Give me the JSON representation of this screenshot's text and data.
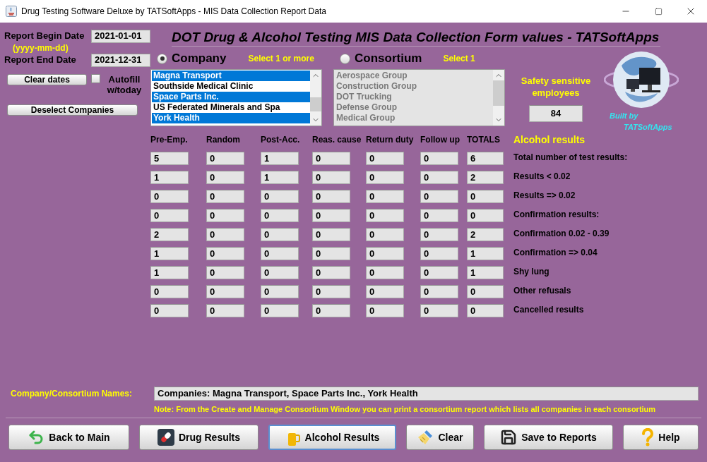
{
  "window": {
    "title": "Drug Testing Software Deluxe by TATSoftApps - MIS Data Collection Report Data"
  },
  "dates": {
    "begin_label": "Report Begin Date",
    "begin_value": "2021-01-01",
    "format_hint": "(yyyy-mm-dd)",
    "end_label": "Report End Date",
    "end_value": "2021-12-31"
  },
  "clear_dates_button": "Clear dates",
  "autofill": {
    "label": "Autofill w/today",
    "checked": false
  },
  "deselect_button": "Deselect Companies",
  "heading": "DOT Drug & Alcohol Testing MIS Data Collection Form values - TATSoftApps",
  "modes": [
    {
      "label": "Company",
      "hint": "Select 1 or more",
      "selected": true,
      "items": [
        {
          "label": "Magna Transport",
          "selected": true
        },
        {
          "label": "Southside Medical Clinic",
          "selected": false
        },
        {
          "label": "Space Parts Inc.",
          "selected": true
        },
        {
          "label": "US Federated Minerals and Spa",
          "selected": false
        },
        {
          "label": "York Health",
          "selected": true
        }
      ]
    },
    {
      "label": "Consortium",
      "hint": "Select 1",
      "selected": false,
      "items": [
        {
          "label": "Aerospace Group",
          "selected": false
        },
        {
          "label": "Construction Group",
          "selected": false
        },
        {
          "label": "DOT Trucking",
          "selected": false
        },
        {
          "label": "Defense Group",
          "selected": false
        },
        {
          "label": "Medical Group",
          "selected": false
        }
      ]
    }
  ],
  "safety": {
    "label": "Safety sensitive employees",
    "value": "84"
  },
  "logo_caption": {
    "line_1": "Built by",
    "line_2": "TATSoftApps"
  },
  "table": {
    "columns": [
      "Pre-Emp.",
      "Random",
      "Post-Acc.",
      "Reas. cause",
      "Return duty",
      "Follow up",
      "TOTALS"
    ],
    "results_title": "Alcohol results",
    "rows": [
      {
        "label": "Total number of test results:",
        "values": [
          "5",
          "0",
          "1",
          "0",
          "0",
          "0",
          "6"
        ]
      },
      {
        "label": "Results < 0.02",
        "values": [
          "1",
          "0",
          "1",
          "0",
          "0",
          "0",
          "2"
        ]
      },
      {
        "label": "Results => 0.02",
        "values": [
          "0",
          "0",
          "0",
          "0",
          "0",
          "0",
          "0"
        ]
      },
      {
        "label": "Confirmation results:",
        "values": [
          "0",
          "0",
          "0",
          "0",
          "0",
          "0",
          "0"
        ]
      },
      {
        "label": "Confirmation 0.02 - 0.39",
        "values": [
          "2",
          "0",
          "0",
          "0",
          "0",
          "0",
          "2"
        ]
      },
      {
        "label": "Confirmation => 0.04",
        "values": [
          "1",
          "0",
          "0",
          "0",
          "0",
          "0",
          "1"
        ]
      },
      {
        "label": "Shy lung",
        "values": [
          "1",
          "0",
          "0",
          "0",
          "0",
          "0",
          "1"
        ]
      },
      {
        "label": "Other refusals",
        "values": [
          "0",
          "0",
          "0",
          "0",
          "0",
          "0",
          "0"
        ]
      },
      {
        "label": "Cancelled results",
        "values": [
          "0",
          "0",
          "0",
          "0",
          "0",
          "0",
          "0"
        ]
      }
    ]
  },
  "names": {
    "label": "Company/Consortium Names:",
    "value": "Companies: Magna Transport, Space Parts Inc., York Health"
  },
  "note": "Note: From the Create and Manage Consortium Window you can print a consortium report which lists all companies in each consortium",
  "buttons": [
    {
      "label": "Back to Main",
      "kind": "back",
      "focused": false
    },
    {
      "label": "Drug Results",
      "kind": "pill",
      "focused": false
    },
    {
      "label": "Alcohol Results",
      "kind": "beer",
      "focused": true
    },
    {
      "label": "Clear",
      "kind": "broom",
      "focused": false
    },
    {
      "label": "Save to Reports",
      "kind": "save",
      "focused": false
    },
    {
      "label": "Help",
      "kind": "help",
      "focused": false
    }
  ]
}
